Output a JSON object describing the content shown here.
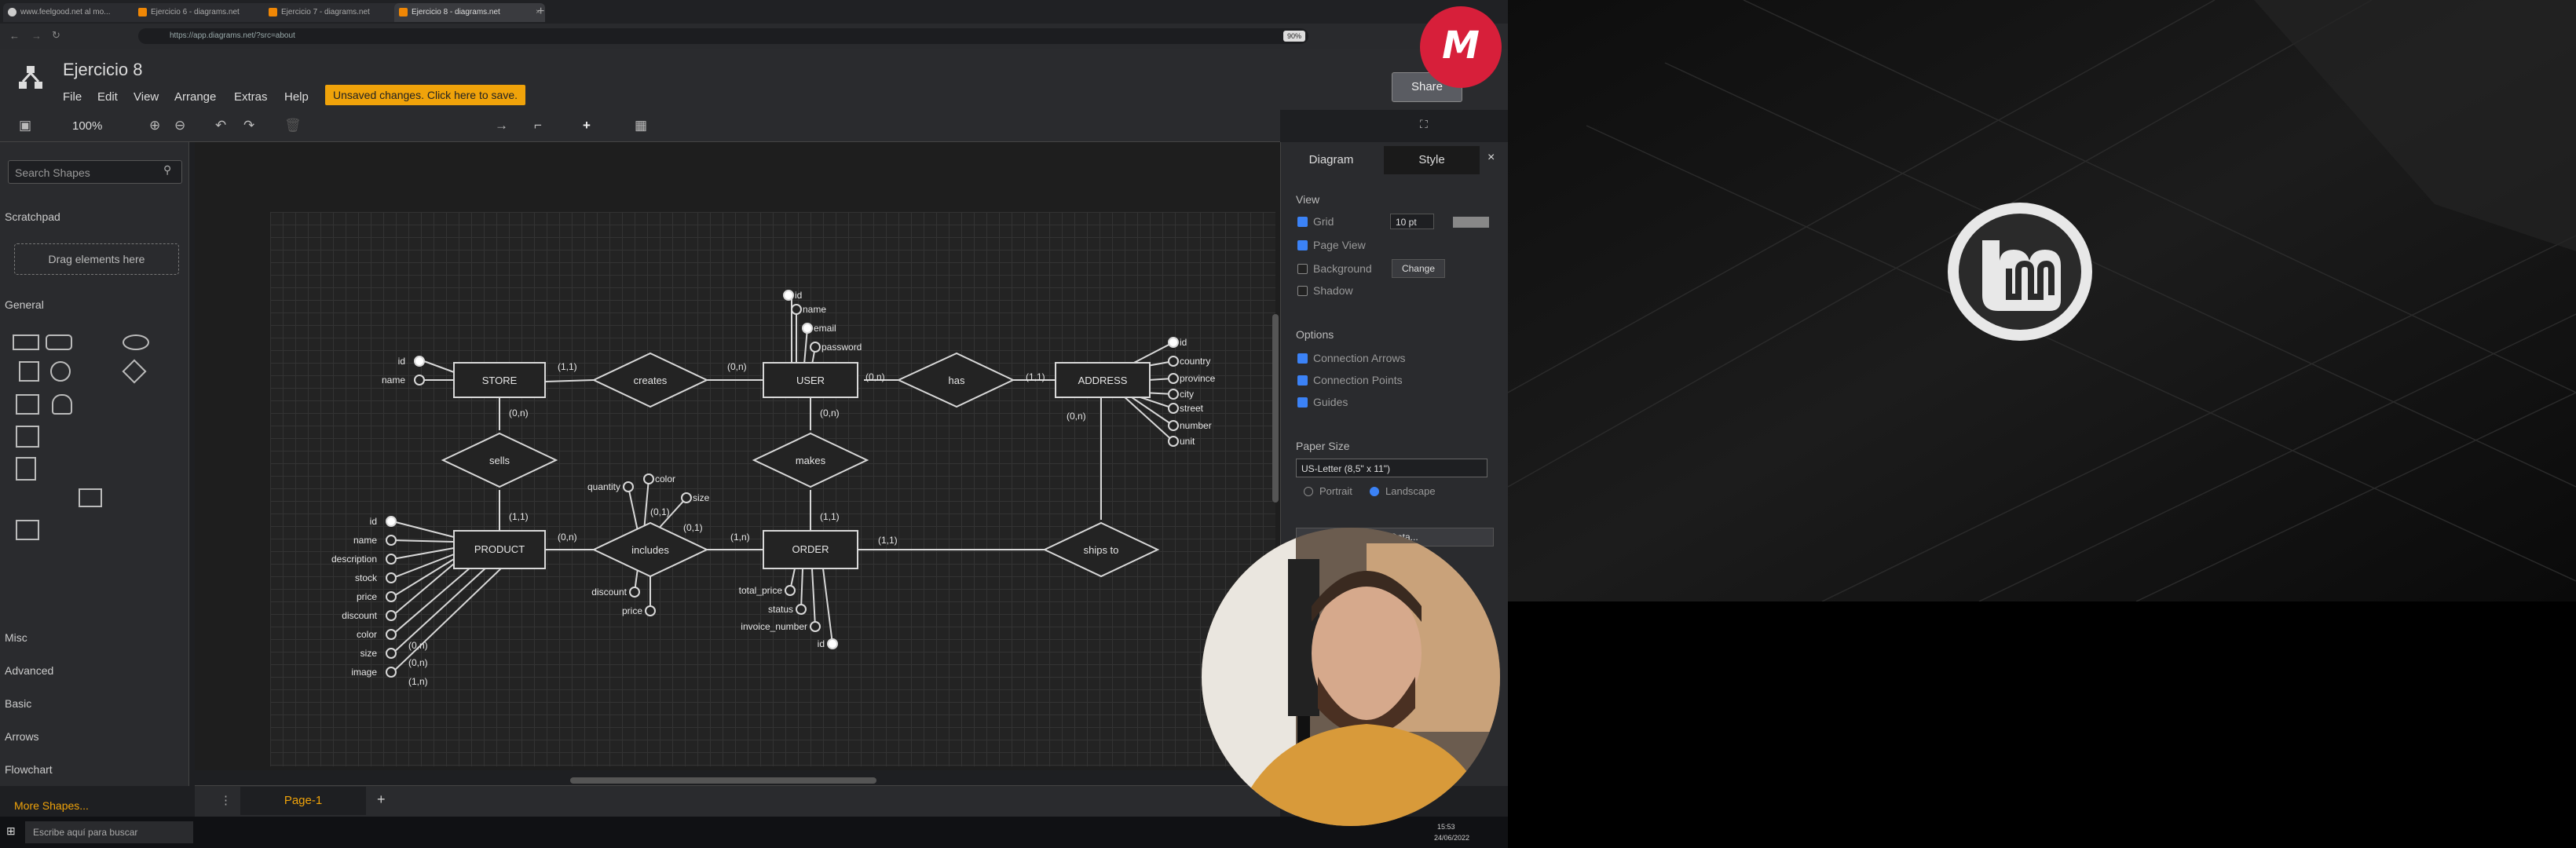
{
  "browser": {
    "tabs": [
      {
        "label": "www.feelgood.net al mo..."
      },
      {
        "label": "Ejercicio 6 - diagrams.net"
      },
      {
        "label": "Ejercicio 7 - diagrams.net"
      },
      {
        "label": "Ejercicio 8 - diagrams.net"
      }
    ],
    "url": "https://app.diagrams.net/?src=about",
    "zoom": "90%"
  },
  "app": {
    "title": "Ejercicio 8",
    "menu": [
      "File",
      "Edit",
      "View",
      "Arrange",
      "Extras",
      "Help"
    ],
    "unsaved_notice": "Unsaved changes. Click here to save.",
    "share_label": "Share",
    "zoom_level": "100%"
  },
  "sidebar": {
    "search_placeholder": "Search Shapes",
    "scratchpad_label": "Scratchpad",
    "drag_hint": "Drag elements here",
    "general_label": "General",
    "sections": [
      "Misc",
      "Advanced",
      "Basic",
      "Arrows",
      "Flowchart"
    ],
    "more_shapes": "More Shapes..."
  },
  "diagram": {
    "entities": {
      "store": "STORE",
      "user": "USER",
      "address": "ADDRESS",
      "product": "PRODUCT",
      "order": "ORDER"
    },
    "relationships": {
      "creates": "creates",
      "has": "has",
      "sells": "sells",
      "makes": "makes",
      "includes": "includes",
      "ships_to": "ships to"
    },
    "store_attrs": [
      "id",
      "name"
    ],
    "user_attrs": [
      "id",
      "name",
      "email",
      "password"
    ],
    "address_attrs": [
      "id",
      "country",
      "province",
      "city",
      "street",
      "number",
      "unit"
    ],
    "product_attrs": [
      "id",
      "name",
      "description",
      "stock",
      "price",
      "discount",
      "color",
      "size",
      "image"
    ],
    "includes_attrs": [
      "quantity",
      "color",
      "size",
      "discount",
      "price"
    ],
    "order_attrs": [
      "total_price",
      "status",
      "invoice_number",
      "id"
    ],
    "cardinalities": {
      "store_creates": "(1,1)",
      "creates_user": "(0,n)",
      "user_has": "(0,n)",
      "has_address": "(1,1)",
      "store_sells": "(0,n)",
      "sells_product": "(1,1)",
      "user_makes": "(0,n)",
      "makes_order": "(1,1)",
      "address_ships": "(0,n)",
      "product_includes": "(0,n)",
      "includes_order": "(1,n)",
      "order_ships": "(1,1)",
      "color_card": "(0,1)",
      "size_card": "(0,1)",
      "p_color": "(0,n)",
      "p_size": "(0,n)",
      "p_image": "(1,n)"
    }
  },
  "format_panel": {
    "tabs": [
      "Diagram",
      "Style"
    ],
    "view_label": "View",
    "grid_label": "Grid",
    "grid_size": "10 pt",
    "page_view_label": "Page View",
    "background_label": "Background",
    "change_label": "Change",
    "shadow_label": "Shadow",
    "options_label": "Options",
    "connection_arrows": "Connection Arrows",
    "connection_points": "Connection Points",
    "guides_label": "Guides",
    "paper_size_label": "Paper Size",
    "paper_size": "US-Letter (8,5\" x 11\")",
    "portrait": "Portrait",
    "landscape": "Landscape",
    "edit_data": "Edit Data..."
  },
  "pages": {
    "current": "Page-1"
  },
  "taskbar": {
    "search": "Escribe aquí para buscar",
    "time": "15:53",
    "date": "24/06/2022"
  },
  "brand": {
    "logo_text": "M",
    "color": "#d71f3a"
  }
}
